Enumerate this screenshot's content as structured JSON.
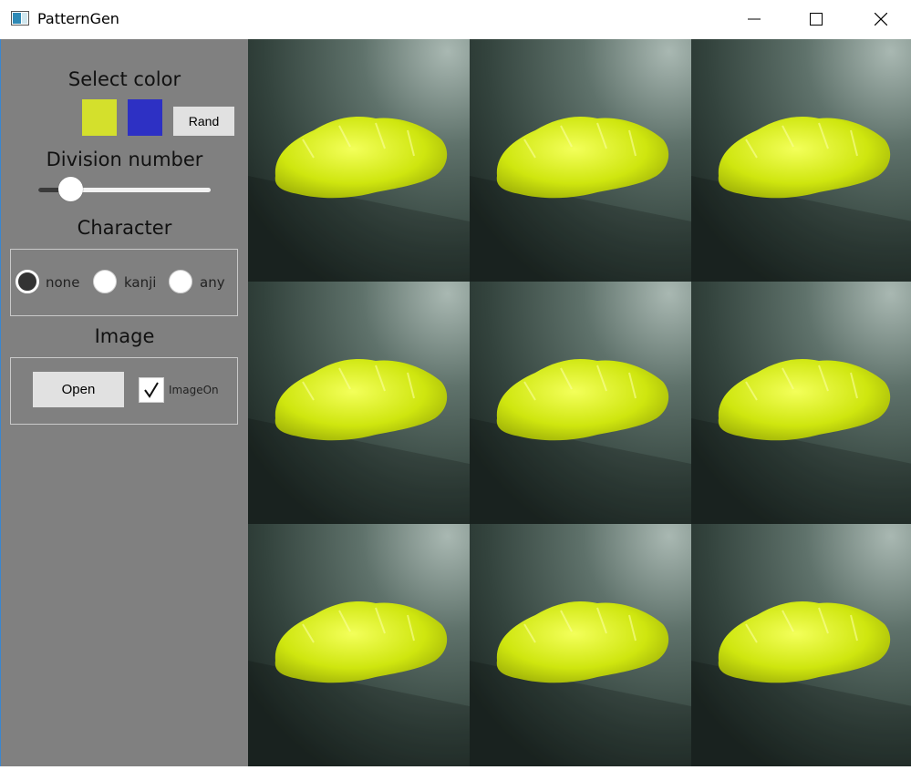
{
  "window": {
    "title": "PatternGen"
  },
  "panel": {
    "select_color": {
      "heading": "Select color",
      "color1": "#d4e02c",
      "color2": "#2d30c4",
      "rand_label": "Rand"
    },
    "division": {
      "heading": "Division number",
      "value_fraction": 0.19
    },
    "character": {
      "heading": "Character",
      "options": [
        "none",
        "kanji",
        "any"
      ],
      "selected": "none"
    },
    "image": {
      "heading": "Image",
      "open_label": "Open",
      "imageon_label": "ImageOn",
      "imageon_checked": true
    }
  },
  "canvas": {
    "grid": {
      "rows": 3,
      "cols": 3
    },
    "tile_subject": "yellow-green crystal rock on dark textured stone"
  }
}
